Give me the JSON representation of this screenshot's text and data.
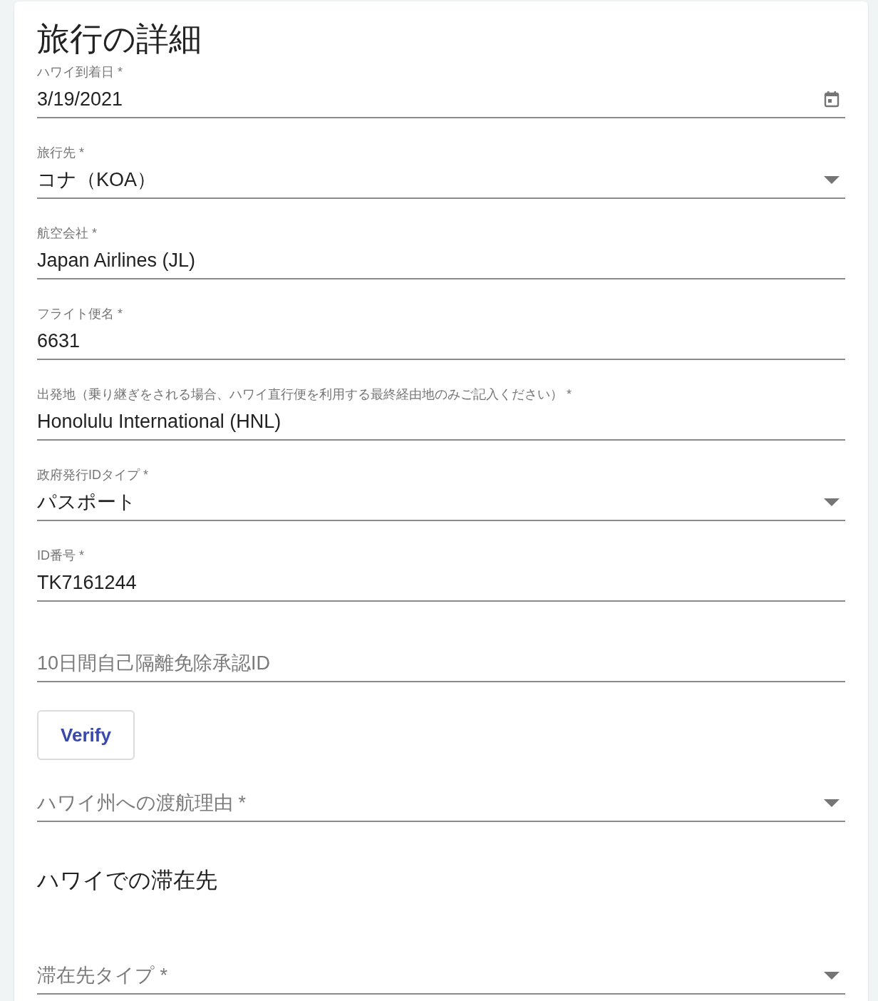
{
  "title": "旅行の詳細",
  "fields": [
    {
      "kind": "date",
      "label": "ハワイ到着日 *",
      "value": "3/19/2021"
    },
    {
      "kind": "select",
      "label": "旅行先 *",
      "value": "コナ（KOA）"
    },
    {
      "kind": "text",
      "label": "航空会社 *",
      "value": "Japan Airlines (JL)"
    },
    {
      "kind": "text",
      "label": "フライト便名 *",
      "value": "6631"
    },
    {
      "kind": "text",
      "label": "出発地（乗り継ぎをされる場合、ハワイ直行便を利用する最終経由地のみご記入ください） *",
      "value": "Honolulu International (HNL)"
    },
    {
      "kind": "select",
      "label": "政府発行IDタイプ *",
      "value": "パスポート"
    },
    {
      "kind": "text",
      "label": "ID番号 *",
      "value": "TK7161244"
    },
    {
      "kind": "text",
      "placeholder": "10日間自己隔離免除承認ID"
    }
  ],
  "verify_button": "Verify",
  "reason_field": {
    "kind": "select",
    "placeholder": "ハワイ州への渡航理由 *"
  },
  "stay_heading": "ハワイでの滞在先",
  "stay_fields": [
    {
      "kind": "select",
      "placeholder": "滞在先タイプ *"
    }
  ]
}
